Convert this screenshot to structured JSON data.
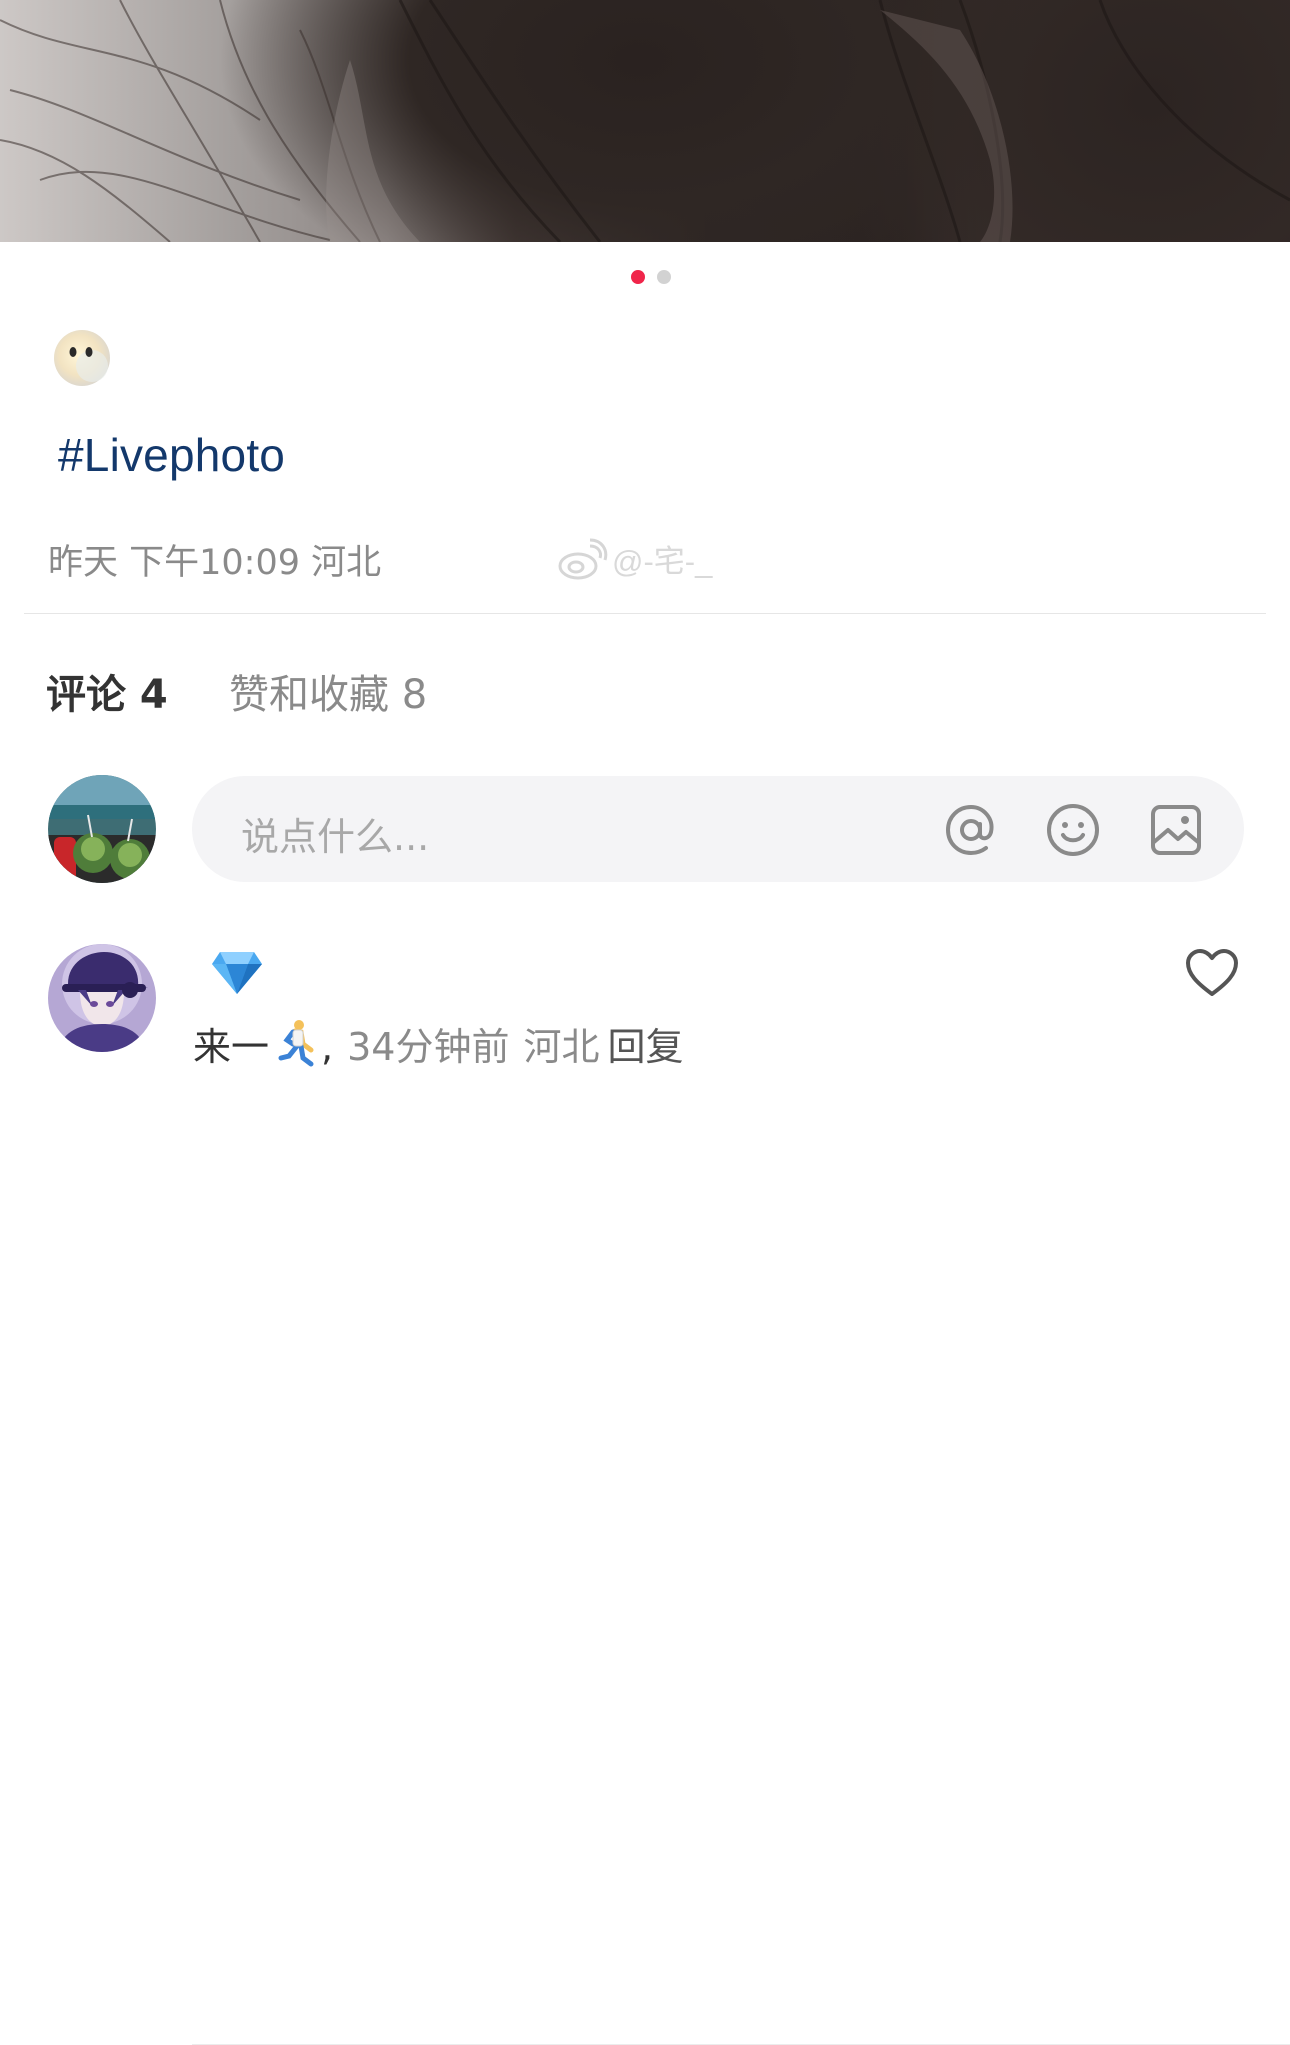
{
  "carousel": {
    "total": 2,
    "active_index": 0,
    "active_color": "#f0254a",
    "inactive_color": "#d2d2d2"
  },
  "post": {
    "emoji_icon": "face-without-mouth-icon",
    "hashtag": "#Livephoto",
    "hashtag_color": "#13386b",
    "meta": "昨天 下午10:09 河北",
    "watermark_handle": "@-宅-_"
  },
  "tabs": [
    {
      "label": "评论 4",
      "active": true
    },
    {
      "label": "赞和收藏 8",
      "active": false
    }
  ],
  "comment_input": {
    "placeholder": "说点什么...",
    "icons": [
      "at-icon",
      "emoji-icon",
      "image-icon"
    ]
  },
  "comments": [
    {
      "badge_icon": "diamond-icon",
      "text": "来一",
      "emoji_icon": "person-running-icon",
      "punct": ",",
      "time": "34分钟前",
      "location": "河北",
      "reply_label": "回复",
      "like_icon": "heart-outline-icon"
    }
  ]
}
